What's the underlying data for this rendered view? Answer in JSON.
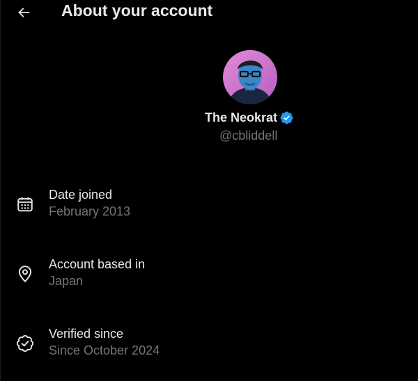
{
  "header": {
    "title": "About your account",
    "back_icon": "arrow-left-icon"
  },
  "profile": {
    "display_name": "The Neokrat",
    "handle": "@cbliddell",
    "verified": true,
    "avatar_alt": "Profile photo"
  },
  "details": [
    {
      "label": "Date joined",
      "value": "February 2013",
      "icon": "calendar-icon"
    },
    {
      "label": "Account based in",
      "value": "Japan",
      "icon": "location-pin-icon"
    },
    {
      "label": "Verified since",
      "value": "Since October 2024",
      "icon": "verified-check-icon"
    }
  ],
  "colors": {
    "background": "#000000",
    "primary_text": "#e7e9ea",
    "secondary_text": "#71767b",
    "verified_blue": "#1d9bf0"
  }
}
